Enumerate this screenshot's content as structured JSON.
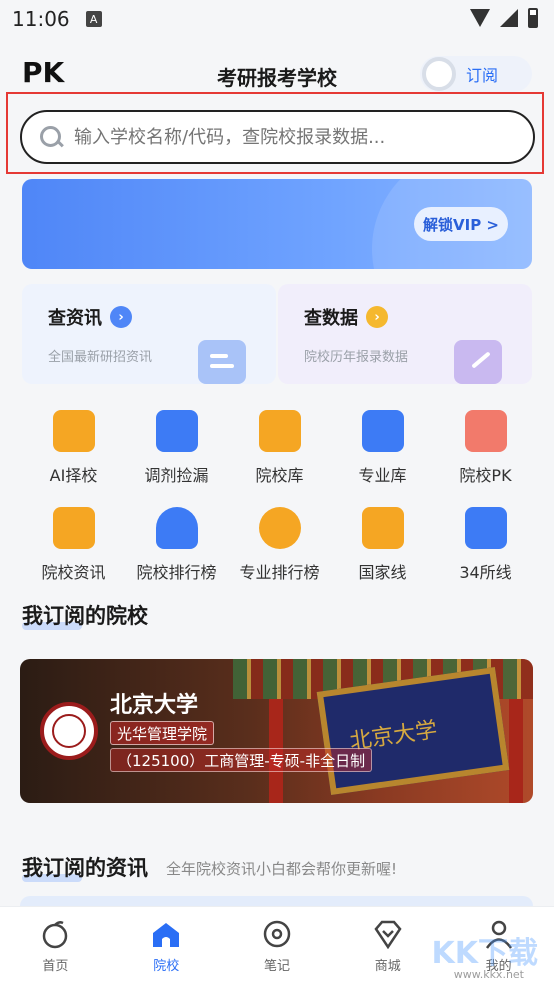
{
  "status": {
    "time": "11:06",
    "indicator": "A"
  },
  "header": {
    "left": "PK",
    "title": "考研报考学校",
    "subscribe": "订阅"
  },
  "search": {
    "placeholder": "输入学校名称/代码，查院校报录数据..."
  },
  "banner": {
    "vip_label": "解锁VIP >"
  },
  "cards": [
    {
      "title": "查资讯",
      "subtitle": "全国最新研招资讯",
      "accent": "#4f86f7"
    },
    {
      "title": "查数据",
      "subtitle": "院校历年报录数据",
      "accent": "#f5b82e"
    }
  ],
  "grid": [
    {
      "label": "AI择校",
      "icon": "graduation-cap-icon",
      "color": "#f5a623"
    },
    {
      "label": "调剂捡漏",
      "icon": "swap-icon",
      "color": "#3d7bf5"
    },
    {
      "label": "院校库",
      "icon": "building-icon",
      "color": "#f5a623"
    },
    {
      "label": "专业库",
      "icon": "folder-icon",
      "color": "#3d7bf5"
    },
    {
      "label": "院校PK",
      "icon": "compare-icon",
      "color": "#f27a6b"
    },
    {
      "label": "院校资讯",
      "icon": "news-icon",
      "color": "#f5a623"
    },
    {
      "label": "院校排行榜",
      "icon": "trophy-icon",
      "color": "#3d7bf5"
    },
    {
      "label": "专业排行榜",
      "icon": "medal-icon",
      "color": "#f5a623"
    },
    {
      "label": "国家线",
      "icon": "trend-line-icon",
      "color": "#f5a623"
    },
    {
      "label": "34所线",
      "icon": "grid-icon",
      "color": "#3d7bf5"
    }
  ],
  "sections": {
    "subscribed_schools": "我订阅的院校",
    "subscribed_news": "我订阅的资讯",
    "news_note": "全年院校资讯小白都会帮你更新喔!"
  },
  "school": {
    "name": "北京大学",
    "department": "光华管理学院",
    "program": "（125100）工商管理-专硕-非全日制",
    "gate_text": "北京大学"
  },
  "tabs": [
    {
      "label": "首页",
      "icon": "home-icon",
      "active": false
    },
    {
      "label": "院校",
      "icon": "school-icon",
      "active": true
    },
    {
      "label": "笔记",
      "icon": "note-icon",
      "active": false
    },
    {
      "label": "商城",
      "icon": "shop-icon",
      "active": false
    },
    {
      "label": "我的",
      "icon": "profile-icon",
      "active": false
    }
  ],
  "watermark": {
    "text": "KK下载",
    "url": "www.kkx.net"
  },
  "colors": {
    "primary": "#2a6ef5",
    "highlight_frame": "#e53935"
  }
}
